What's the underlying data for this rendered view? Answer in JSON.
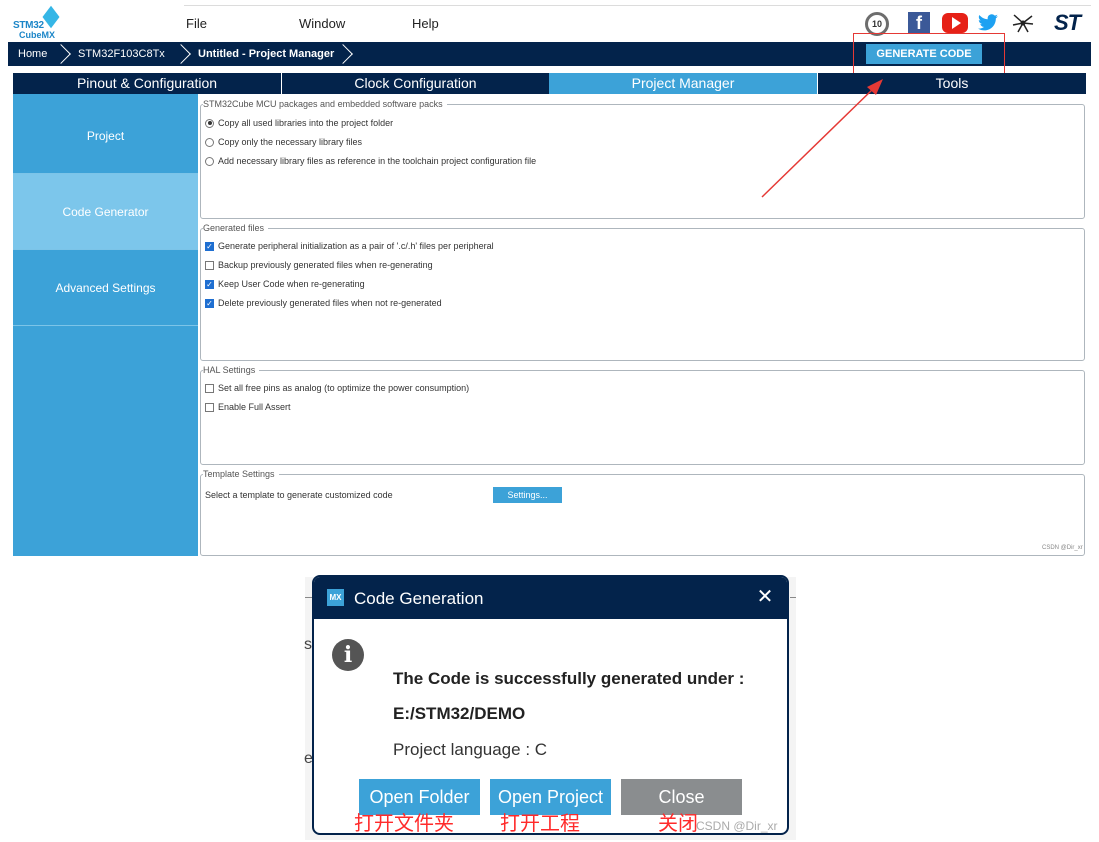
{
  "logo": {
    "line1": "STM32",
    "line2": "CubeMX"
  },
  "menu": {
    "file": "File",
    "window": "Window",
    "help": "Help"
  },
  "social": {
    "anniv": "10",
    "facebook": "f",
    "st": "ST"
  },
  "breadcrumb": {
    "home": "Home",
    "device": "STM32F103C8Tx",
    "project": "Untitled - Project Manager"
  },
  "generate_button": "GENERATE CODE",
  "tabs": [
    "Pinout & Configuration",
    "Clock Configuration",
    "Project Manager",
    "Tools"
  ],
  "nav": [
    "Project",
    "Code Generator",
    "Advanced Settings"
  ],
  "packs": {
    "title": "STM32Cube MCU packages and embedded software packs",
    "options": [
      "Copy all used libraries into the project folder",
      "Copy only the necessary library files",
      "Add necessary library files as reference in the toolchain project configuration file"
    ],
    "selected_index": 0
  },
  "generated_files": {
    "title": "Generated files",
    "options": [
      "Generate peripheral initialization as a pair of '.c/.h' files per peripheral",
      "Backup previously generated files when re-generating",
      "Keep User Code when re-generating",
      "Delete previously generated files when not re-generated"
    ],
    "checked": [
      true,
      false,
      true,
      true
    ]
  },
  "hal": {
    "title": "HAL Settings",
    "options": [
      "Set all free pins as analog (to optimize the power consumption)",
      "Enable Full Assert"
    ],
    "checked": [
      false,
      false
    ]
  },
  "template": {
    "title": "Template Settings",
    "text": "Select a template to generate customized code",
    "button": "Settings..."
  },
  "watermark_small": "CSDN @Dir_xr",
  "colors": {
    "navy": "#03234b",
    "accent": "#3ca2d8",
    "annotation_red": "#e53935"
  },
  "dialog": {
    "logo": "MX",
    "title": "Code Generation",
    "close": "✕",
    "info": "i",
    "message": "The Code is successfully generated under :",
    "path": "E:/STM32/DEMO",
    "language": "Project language : C",
    "buttons": [
      "Open Folder",
      "Open Project",
      "Close"
    ],
    "annotations": [
      "打开文件夹",
      "打开工程",
      "关闭"
    ],
    "behind_chars": [
      "s",
      "e"
    ],
    "watermark": "CSDN @Dir_xr"
  }
}
